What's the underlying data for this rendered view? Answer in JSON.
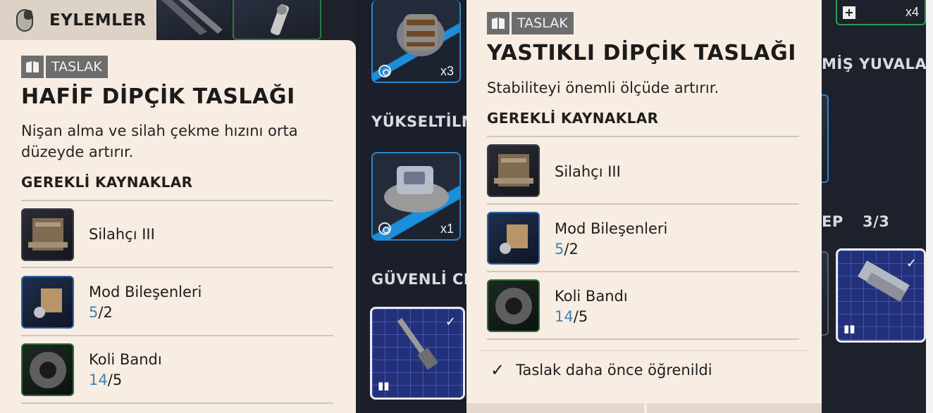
{
  "actions_tab": {
    "label": "EYLEMLER",
    "icon": "mouse-icon"
  },
  "background": {
    "headings": {
      "upgraded": "YÜKSELTİLM",
      "secure": "GÜVENLİ CE",
      "slots": "MİŞ YUVALAR",
      "ep": "EP",
      "ep_count": "3/3"
    },
    "tiles": {
      "barrel_qty": "x3",
      "device_qty": "x1",
      "top_right_qty": "x4"
    }
  },
  "left_panel": {
    "badge": "TASLAK",
    "title": "HAFİF DİPÇİK TASLAĞI",
    "description": "Nişan alma ve silah çekme hızını orta düzeyde artırır.",
    "resources_heading": "GEREKLİ KAYNAKLAR",
    "resources": [
      {
        "name": "Silahçı III",
        "count": "",
        "have": "",
        "need": ""
      },
      {
        "name": "Mod Bileşenleri",
        "have": "5",
        "need": "2"
      },
      {
        "name": "Koli Bandı",
        "have": "14",
        "need": "5"
      }
    ]
  },
  "right_panel": {
    "badge": "TASLAK",
    "title": "YASTIKLI DİPÇİK TASLAĞI",
    "description": "Stabiliteyi önemli ölçüde artırır.",
    "resources_heading": "GEREKLİ KAYNAKLAR",
    "resources": [
      {
        "name": "Silahçı III"
      },
      {
        "name": "Mod Bileşenleri",
        "have": "5",
        "need": "2"
      },
      {
        "name": "Koli Bandı",
        "have": "14",
        "need": "5"
      }
    ],
    "learned_text": "Taslak daha önce öğrenildi"
  },
  "colors": {
    "panel_bg": "#f8ede2",
    "badge_bg": "#6d6d6d",
    "have_count": "#3f85b5",
    "background": "#1b1f2b"
  }
}
